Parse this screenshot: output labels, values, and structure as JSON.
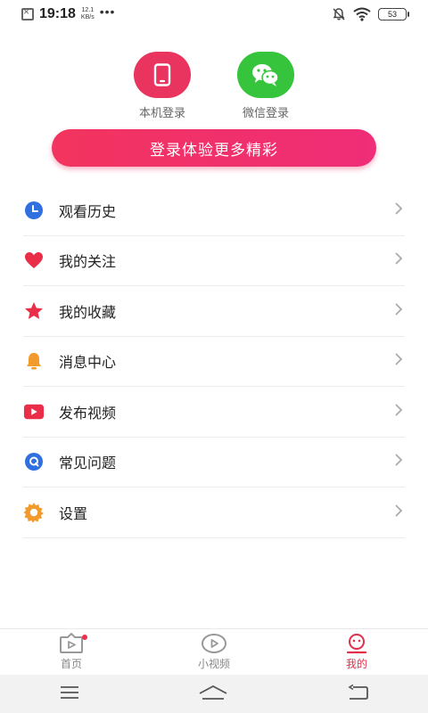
{
  "status_bar": {
    "time": "19:18",
    "net_speed_value": "12.1",
    "net_speed_unit": "KB/s",
    "more": "•••",
    "battery": "53"
  },
  "login_options": [
    {
      "label": "本机登录",
      "icon": "phone-icon",
      "color": "#e8345f"
    },
    {
      "label": "微信登录",
      "icon": "wechat-icon",
      "color": "#35c43b"
    }
  ],
  "login_button": {
    "label": "登录体验更多精彩"
  },
  "menu": [
    {
      "label": "观看历史",
      "icon": "clock-icon"
    },
    {
      "label": "我的关注",
      "icon": "heart-icon"
    },
    {
      "label": "我的收藏",
      "icon": "star-icon"
    },
    {
      "label": "消息中心",
      "icon": "bell-icon"
    },
    {
      "label": "发布视频",
      "icon": "video-play-icon"
    },
    {
      "label": "常见问题",
      "icon": "question-icon"
    },
    {
      "label": "设置",
      "icon": "gear-icon"
    }
  ],
  "tabs": [
    {
      "label": "首页",
      "icon": "home-video-icon",
      "active": false,
      "badge": true
    },
    {
      "label": "小视频",
      "icon": "small-video-icon",
      "active": false,
      "badge": false
    },
    {
      "label": "我的",
      "icon": "profile-icon",
      "active": true,
      "badge": false
    }
  ],
  "colors": {
    "accent": "#e0304a",
    "wechat": "#35c43b"
  }
}
